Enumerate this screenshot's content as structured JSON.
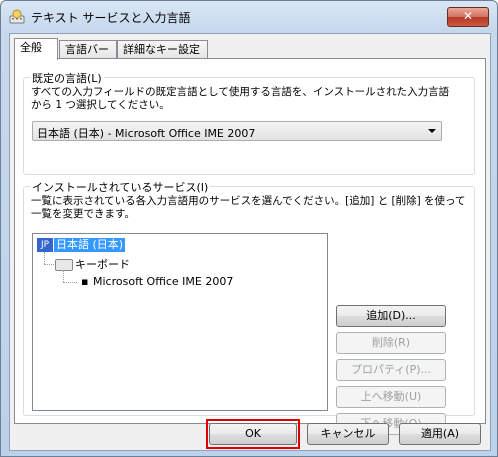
{
  "window": {
    "title": "テキスト サービスと入力言語",
    "close_glyph": "✕"
  },
  "tabs": [
    {
      "label": "全般",
      "active": true
    },
    {
      "label": "言語バー",
      "active": false
    },
    {
      "label": "詳細なキー設定",
      "active": false
    }
  ],
  "default_language": {
    "group_label": "既定の言語(L)",
    "description_line1": "すべての入力フィールドの既定言語として使用する言語を、インストールされた入力言語",
    "description_line2": "から 1 つ選択してください。",
    "selected": "日本語 (日本) - Microsoft Office IME 2007"
  },
  "installed_services": {
    "group_label": "インストールされているサービス(I)",
    "description_line1": "一覧に表示されている各入力言語用のサービスを選んでください。[追加] と [削除] を使って",
    "description_line2": "一覧を変更できます。",
    "tree": {
      "language_icon": "JP",
      "language": "日本語 (日本)",
      "category": "キーボード",
      "service": "Microsoft Office IME 2007"
    },
    "buttons": {
      "add": "追加(D)...",
      "remove": "削除(R)",
      "properties": "プロパティ(P)...",
      "move_up": "上へ移動(U)",
      "move_down": "下へ移動(O)"
    }
  },
  "footer": {
    "ok": "OK",
    "cancel": "キャンセル",
    "apply": "適用(A)"
  },
  "colors": {
    "highlight": "#e00000",
    "selection": "#3399ff"
  }
}
